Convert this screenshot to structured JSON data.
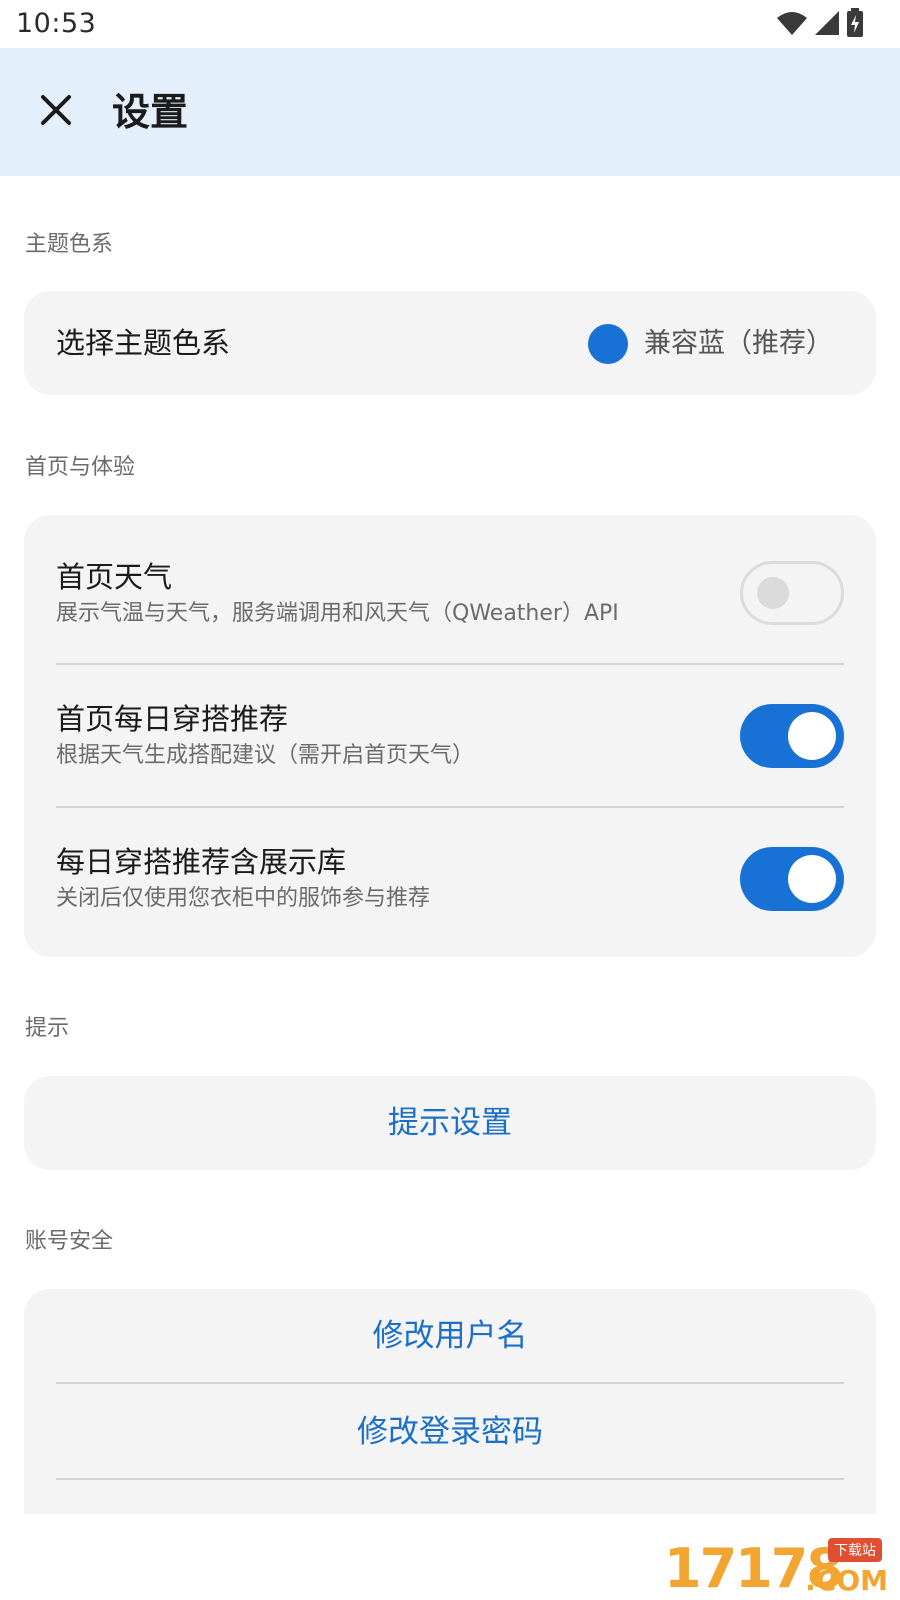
{
  "status_bar": {
    "time": "10:53",
    "icons": [
      "wifi-icon",
      "signal-icon",
      "battery-charging-icon"
    ]
  },
  "app_bar": {
    "title": "设置",
    "close_icon": "close-icon",
    "background": "#e3f0fc"
  },
  "sections": {
    "theme": {
      "label": "主题色系",
      "row_title": "选择主题色系",
      "value": "兼容蓝（推荐）",
      "color": "#1872d6"
    },
    "home": {
      "label": "首页与体验",
      "items": [
        {
          "title": "首页天气",
          "subtitle": "展示气温与天气，服务端调用和风天气（QWeather）API",
          "enabled": false
        },
        {
          "title": "首页每日穿搭推荐",
          "subtitle": "根据天气生成搭配建议（需开启首页天气）",
          "enabled": true
        },
        {
          "title": "每日穿搭推荐含展示库",
          "subtitle": "关闭后仅使用您衣柜中的服饰参与推荐",
          "enabled": true
        }
      ]
    },
    "tips": {
      "label": "提示",
      "button": "提示设置"
    },
    "account": {
      "label": "账号安全",
      "buttons": [
        "修改用户名",
        "修改登录密码"
      ]
    }
  },
  "watermark": {
    "number": "17178",
    "badge": "下载站",
    "suffix": ".COM"
  },
  "colors": {
    "accent": "#1872d6",
    "link": "#1a6fc9",
    "card": "#f4f4f4"
  }
}
